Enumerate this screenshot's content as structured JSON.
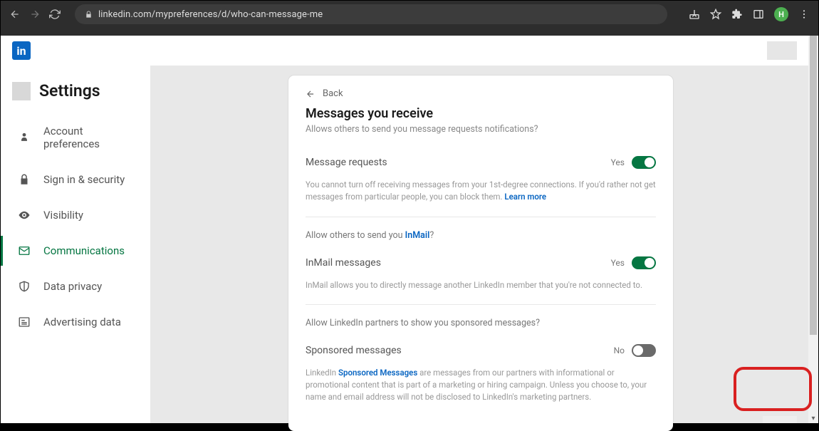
{
  "browser": {
    "url": "linkedin.com/mypreferences/d/who-can-message-me",
    "avatar_letter": "H"
  },
  "topbar": {
    "logo_text": "in"
  },
  "sidebar": {
    "title": "Settings",
    "items": [
      {
        "label": "Account preferences"
      },
      {
        "label": "Sign in & security"
      },
      {
        "label": "Visibility"
      },
      {
        "label": "Communications"
      },
      {
        "label": "Data privacy"
      },
      {
        "label": "Advertising data"
      }
    ]
  },
  "card": {
    "back_label": "Back",
    "title": "Messages you receive",
    "subtitle": "Allows others to send you message requests notifications?",
    "toggle_yes": "Yes",
    "toggle_no": "No",
    "section1": {
      "label": "Message requests",
      "help_a": "You cannot turn off receiving messages from your 1st-degree connections. If you'd rather not get messages from particular people, you can block them. ",
      "help_link": "Learn more"
    },
    "section2": {
      "question_a": "Allow others to send you ",
      "question_link": "InMail",
      "question_b": "?",
      "label": "InMail messages",
      "help": "InMail allows you to directly message another LinkedIn member that you're not connected to."
    },
    "section3": {
      "question": "Allow LinkedIn partners to show you sponsored messages?",
      "label": "Sponsored messages",
      "help_a": "LinkedIn ",
      "help_link": "Sponsored Messages",
      "help_b": " are messages from our partners with informational or promotional content that is part of a marketing or hiring campaign. Unless you choose to, your name and email address will not be disclosed to LinkedIn's marketing partners."
    }
  }
}
